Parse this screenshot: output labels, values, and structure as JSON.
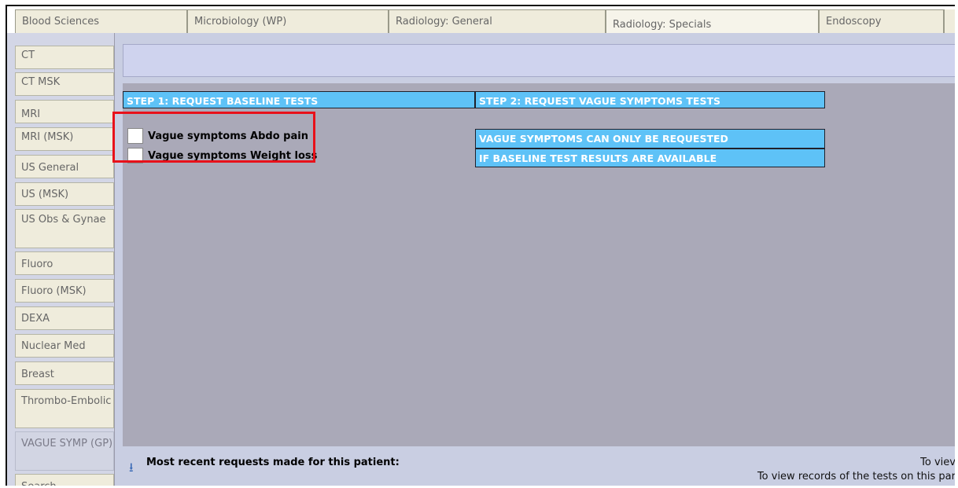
{
  "tabs": [
    {
      "label": "Blood Sciences"
    },
    {
      "label": "Microbiology (WP)"
    },
    {
      "label": "Radiology: General"
    },
    {
      "label": "Radiology: Specials"
    },
    {
      "label": "Endoscopy"
    }
  ],
  "sidebar": {
    "items": [
      {
        "label": "CT"
      },
      {
        "label": "CT MSK"
      },
      {
        "label": "MRI"
      },
      {
        "label": "MRI (MSK)"
      },
      {
        "label": "US General"
      },
      {
        "label": "US (MSK)"
      },
      {
        "label": "US Obs & Gynae"
      },
      {
        "label": "Fluoro"
      },
      {
        "label": "Fluoro (MSK)"
      },
      {
        "label": "DEXA"
      },
      {
        "label": "Nuclear Med"
      },
      {
        "label": "Breast"
      },
      {
        "label": "Thrombo-Embolic"
      },
      {
        "label": "VAGUE SYMP (GP)"
      },
      {
        "label": "Search"
      }
    ]
  },
  "main": {
    "step1_header": "STEP 1: REQUEST BASELINE TESTS",
    "step2_header": "STEP 2: REQUEST VAGUE SYMPTOMS TESTS",
    "options": [
      {
        "label": "Vague symptoms Abdo pain",
        "checked": false
      },
      {
        "label": "Vague symptoms Weight loss",
        "checked": false
      }
    ],
    "notice_line1": "VAGUE SYMPTOMS CAN ONLY BE REQUESTED",
    "notice_line2": "IF BASELINE TEST RESULTS ARE AVAILABLE",
    "recent_label": "Most recent requests made for this patient:",
    "view_text_1": "To viev",
    "view_text_2": "To view records of the tests on this par"
  },
  "colors": {
    "header_blue": "#5ec2f7",
    "content_bg": "#aaa9b8",
    "highlight_red": "#e8111a",
    "tab_bg": "#efecdc"
  },
  "icons": {
    "recent_toggle": "down-arrow-icon"
  }
}
